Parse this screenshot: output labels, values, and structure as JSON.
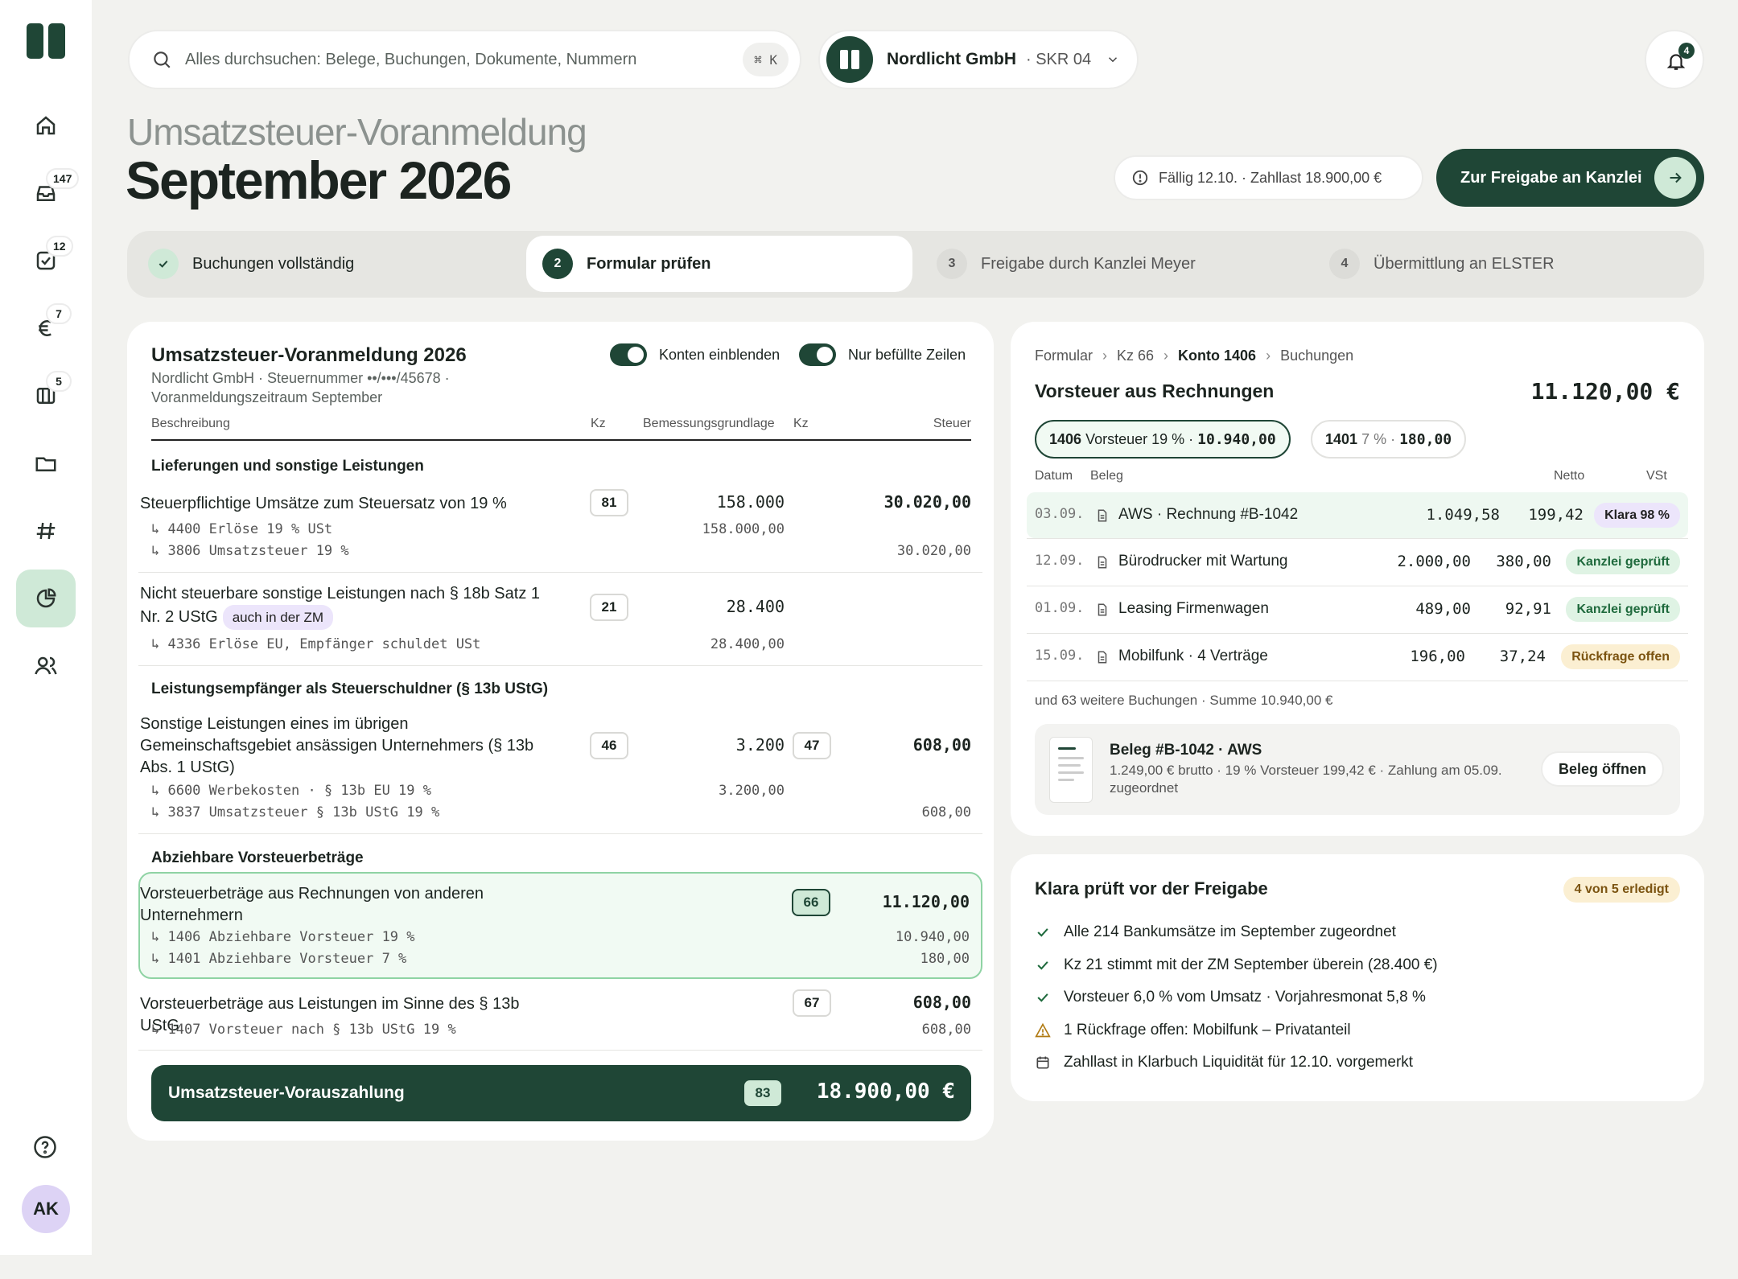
{
  "search": {
    "placeholder": "Alles durchsuchen: Belege, Buchungen, Dokumente, Nummern",
    "shortcut": "⌘ K"
  },
  "company": {
    "name": "Nordlicht GmbH",
    "plan": "· SKR 04"
  },
  "notifications": {
    "count": "4"
  },
  "sidebar": {
    "inbox_badge": "147",
    "tasks_badge": "12",
    "finance_badge": "7",
    "table_badge": "5",
    "avatar": "AK"
  },
  "header": {
    "subtitle": "Umsatzsteuer-Voranmeldung",
    "title": "September 2026",
    "due": "Fällig 12.10. · Zahllast 18.900,00 €",
    "primary_button": "Zur Freigabe an Kanzlei"
  },
  "steps": [
    {
      "num": "✓",
      "label": "Buchungen vollständig"
    },
    {
      "num": "2",
      "label": "Formular prüfen"
    },
    {
      "num": "3",
      "label": "Freigabe durch Kanzlei Meyer"
    },
    {
      "num": "4",
      "label": "Übermittlung an ELSTER"
    }
  ],
  "form": {
    "title": "Umsatzsteuer-Voranmeldung 2026",
    "subtitle": "Nordlicht GmbH · Steuernummer ••/•••/45678 · Voranmeldungszeitraum September",
    "toggle1": "Konten einblenden",
    "toggle2": "Nur befüllte Zeilen",
    "headers": {
      "desc": "Beschreibung",
      "kz": "Kz",
      "base": "Bemessungsgrundlage",
      "kz2": "Kz",
      "tax": "Steuer"
    },
    "sec1": "Lieferungen und sonstige Leistungen",
    "r1": {
      "desc": "Steuerpflichtige Umsätze zum Steuersatz von 19 %",
      "kz": "81",
      "base": "158.000",
      "tax": "30.020,00",
      "acc1": "↳ 4400 Erlöse 19 % USt",
      "acc2": "↳ 3806 Umsatzsteuer 19 %",
      "acc1v": "158.000,00",
      "acc2v": "30.020,00"
    },
    "r2": {
      "desc": "Nicht steuerbare sonstige Leistungen nach § 18b Satz 1 Nr. 2 UStG",
      "tag": "auch in der ZM",
      "kz": "21",
      "base": "28.400",
      "acc1": "↳ 4336 Erlöse EU, Empfänger schuldet USt",
      "acc1v": "28.400,00"
    },
    "sec2": "Leistungsempfänger als Steuerschuldner (§ 13b UStG)",
    "r3": {
      "desc": "Sonstige Leistungen eines im übrigen Gemeinschaftsgebiet ansässigen Unternehmers (§ 13b Abs. 1 UStG)",
      "kz": "46",
      "base": "3.200",
      "kz2": "47",
      "tax": "608,00",
      "acc1": "↳ 6600 Werbekosten · § 13b EU 19 %",
      "acc2": "↳ 3837 Umsatzsteuer § 13b UStG 19 %",
      "acc1v": "3.200,00",
      "acc2v": "608,00"
    },
    "sec3": "Abziehbare Vorsteuerbeträge",
    "r4": {
      "desc": "Vorsteuerbeträge aus Rechnungen von anderen Unternehmern",
      "kz": "66",
      "tax": "11.120,00",
      "acc1": "↳ 1406 Abziehbare Vorsteuer 19 %",
      "acc2": "↳ 1401 Abziehbare Vorsteuer 7 %",
      "acc1v": "10.940,00",
      "acc2v": "180,00"
    },
    "r5": {
      "desc": "Vorsteuerbeträge aus Leistungen im Sinne des § 13b UStG",
      "kz": "67",
      "tax": "608,00",
      "acc1": "↳ 1407 Vorsteuer nach § 13b UStG 19 %",
      "acc1v": "608,00"
    },
    "total": {
      "label": "Umsatzsteuer-Vorauszahlung",
      "kz": "83",
      "value": "18.900,00 €"
    }
  },
  "detail": {
    "crumbs": [
      "Formular",
      "Kz 66",
      "Konto 1406",
      "Buchungen"
    ],
    "title": "Vorsteuer aus Rechnungen",
    "amount": "11.120,00 €",
    "chip1": {
      "acc": "1406",
      "name": "Vorsteuer 19 % ·",
      "val": "10.940,00"
    },
    "chip2": {
      "acc": "1401",
      "name": "7 % ·",
      "val": "180,00"
    },
    "headers": {
      "date": "Datum",
      "doc": "Beleg",
      "net": "Netto",
      "vat": "VSt"
    },
    "rows": [
      {
        "date": "03.09.",
        "doc": "AWS · Rechnung #B-1042",
        "net": "1.049,58",
        "vat": "199,42",
        "status": "Klara 98 %"
      },
      {
        "date": "12.09.",
        "doc": "Bürodrucker mit Wartung",
        "net": "2.000,00",
        "vat": "380,00",
        "status": "Kanzlei geprüft"
      },
      {
        "date": "01.09.",
        "doc": "Leasing Firmenwagen",
        "net": "489,00",
        "vat": "92,91",
        "status": "Kanzlei geprüft"
      },
      {
        "date": "15.09.",
        "doc": "Mobilfunk · 4 Verträge",
        "net": "196,00",
        "vat": "37,24",
        "status": "Rückfrage offen"
      }
    ],
    "more": "und 63 weitere Buchungen · Summe 10.940,00 €",
    "beleg": {
      "title": "Beleg #B-1042 · AWS",
      "desc": "1.249,00 € brutto · 19 % Vorsteuer 199,42 € · Zahlung am 05.09. zugeordnet",
      "button": "Beleg öffnen"
    }
  },
  "checks": {
    "title": "Klara prüft vor der Freigabe",
    "badge": "4 von 5 erledigt",
    "items": [
      "Alle 214 Bankumsätze im September zugeordnet",
      "Kz 21 stimmt mit der ZM September überein (28.400 €)",
      "Vorsteuer 6,0 % vom Umsatz · Vorjahresmonat 5,8 %",
      "1 Rückfrage offen: Mobilfunk – Privatanteil",
      "Zahllast in Klarbuch Liquidität für 12.10. vorgemerkt"
    ]
  }
}
